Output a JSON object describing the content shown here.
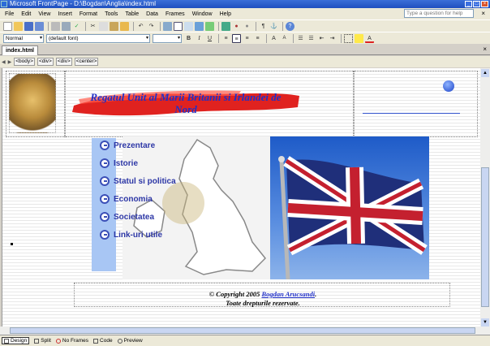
{
  "window": {
    "title": "Microsoft FrontPage - D:\\Bogdan\\Anglia\\index.html"
  },
  "menu": {
    "items": [
      "File",
      "Edit",
      "View",
      "Insert",
      "Format",
      "Tools",
      "Table",
      "Data",
      "Frames",
      "Window",
      "Help"
    ],
    "help_placeholder": "Type a question for help"
  },
  "formatting": {
    "style": "Normal",
    "font": "(default font)"
  },
  "tabs": {
    "active": "index.html"
  },
  "tags": [
    "<body>",
    "<div>",
    "<div>",
    "<center>"
  ],
  "page": {
    "title_line1": "Regatul Unit al Marii Britanii si Irlandei de",
    "title_line2": "Nord",
    "nav": [
      "Prezentare",
      "Istorie",
      "Statul si politica",
      "Economia",
      "Societatea",
      "Link-uri utile"
    ],
    "footer_prefix": "© Copyright 2005 ",
    "footer_author": "Bogdan Arucsandi",
    "footer_suffix": ".",
    "footer_line2": "Toate drepturile rezervate."
  },
  "views": {
    "design": "Design",
    "split": "Split",
    "no_frames": "No Frames",
    "code": "Code",
    "preview": "Preview"
  },
  "colors": {
    "title_blue": "#1f2fc8",
    "brush_red": "#e0221f",
    "nav_blue": "#2d37a6",
    "strip_blue": "#a8c6f4"
  }
}
